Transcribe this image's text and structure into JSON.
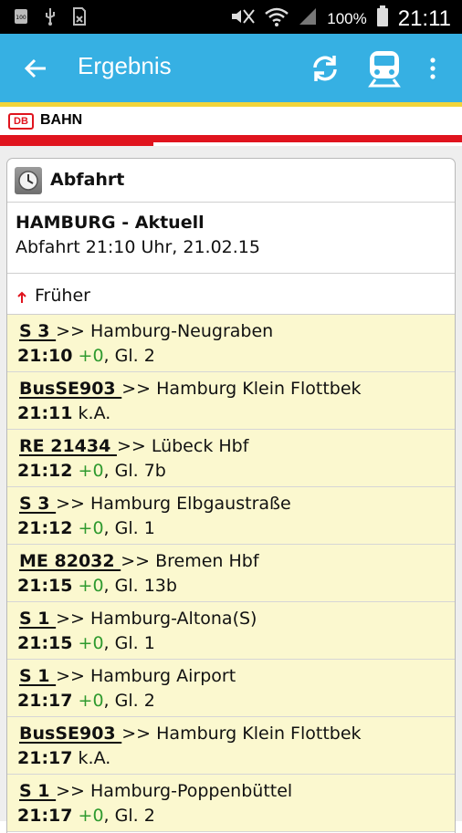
{
  "status_bar": {
    "battery_percent": "100%",
    "time": "21:11",
    "icons": [
      "notification-100-icon",
      "usb-icon",
      "download-icon",
      "mute-icon",
      "wifi-icon",
      "signal-icon",
      "battery-icon"
    ]
  },
  "app_bar": {
    "title": "Ergebnis",
    "color": "#36b0e3",
    "icons": [
      "back-arrow-icon",
      "refresh-icon",
      "train-icon",
      "overflow-menu-icon"
    ]
  },
  "brand": {
    "logo": "DB",
    "name": "BAHN",
    "color": "#e0141e"
  },
  "board": {
    "heading": "Abfahrt",
    "station": "HAMBURG - Aktuell",
    "departure_info": "Abfahrt 21:10 Uhr, 21.02.15",
    "earlier_label": "Früher",
    "departures": [
      {
        "train": "S 3 ",
        "destination": " >> Hamburg-Neugraben",
        "time": "21:10",
        "delay": " +0",
        "platform": ",  Gl. 2"
      },
      {
        "train": "BusSE903 ",
        "destination": " >> Hamburg Klein Flottbek",
        "time": "21:11",
        "delay": "",
        "platform": " k.A."
      },
      {
        "train": "RE 21434 ",
        "destination": " >> Lübeck Hbf",
        "time": "21:12",
        "delay": " +0",
        "platform": ",  Gl. 7b"
      },
      {
        "train": "S 3 ",
        "destination": " >> Hamburg Elbgaustraße",
        "time": "21:12",
        "delay": " +0",
        "platform": ",  Gl. 1"
      },
      {
        "train": "ME 82032 ",
        "destination": " >> Bremen Hbf",
        "time": "21:15",
        "delay": " +0",
        "platform": ",  Gl. 13b"
      },
      {
        "train": "S 1 ",
        "destination": " >> Hamburg-Altona(S)",
        "time": "21:15",
        "delay": " +0",
        "platform": ",  Gl. 1"
      },
      {
        "train": "S 1 ",
        "destination": " >> Hamburg Airport",
        "time": "21:17",
        "delay": " +0",
        "platform": ",  Gl. 2"
      },
      {
        "train": "BusSE903 ",
        "destination": " >> Hamburg Klein Flottbek",
        "time": "21:17",
        "delay": "",
        "platform": " k.A."
      },
      {
        "train": "S 1 ",
        "destination": " >> Hamburg-Poppenbüttel",
        "time": "21:17",
        "delay": " +0",
        "platform": ",  Gl. 2"
      }
    ]
  }
}
